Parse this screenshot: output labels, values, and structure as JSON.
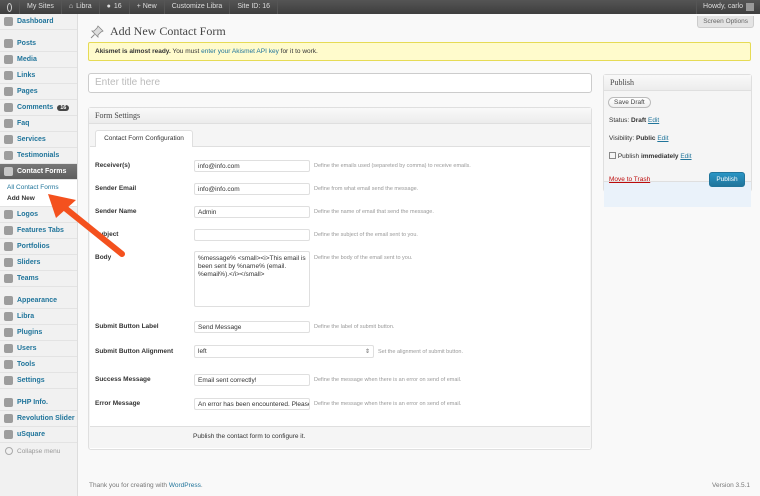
{
  "adminbar": {
    "items": [
      "My Sites",
      "Libra",
      "16",
      "+ New",
      "Customize Libra",
      "Site ID: 16"
    ],
    "howdy": "Howdy, carlo"
  },
  "sidebar": {
    "items": [
      {
        "label": "Dashboard",
        "icon": "dashboard-icon"
      },
      {
        "label": "Posts",
        "icon": "posts-icon"
      },
      {
        "label": "Media",
        "icon": "media-icon"
      },
      {
        "label": "Links",
        "icon": "links-icon"
      },
      {
        "label": "Pages",
        "icon": "pages-icon"
      },
      {
        "label": "Comments",
        "icon": "comments-icon",
        "badge": "16"
      },
      {
        "label": "Faq",
        "icon": "faq-icon"
      },
      {
        "label": "Services",
        "icon": "services-icon"
      },
      {
        "label": "Testimonials",
        "icon": "testimonials-icon"
      },
      {
        "label": "Contact Forms",
        "icon": "contact-forms-icon"
      },
      {
        "label": "Logos",
        "icon": "logos-icon"
      },
      {
        "label": "Features Tabs",
        "icon": "features-tabs-icon"
      },
      {
        "label": "Portfolios",
        "icon": "portfolios-icon"
      },
      {
        "label": "Sliders",
        "icon": "sliders-icon"
      },
      {
        "label": "Teams",
        "icon": "teams-icon"
      },
      {
        "label": "Appearance",
        "icon": "appearance-icon"
      },
      {
        "label": "Libra",
        "icon": "libra-icon"
      },
      {
        "label": "Plugins",
        "icon": "plugins-icon"
      },
      {
        "label": "Users",
        "icon": "users-icon"
      },
      {
        "label": "Tools",
        "icon": "tools-icon"
      },
      {
        "label": "Settings",
        "icon": "settings-icon"
      },
      {
        "label": "PHP Info.",
        "icon": "php-info-icon"
      },
      {
        "label": "Revolution Slider",
        "icon": "revolution-slider-icon"
      },
      {
        "label": "uSquare",
        "icon": "usquare-icon"
      }
    ],
    "submenu": [
      "All Contact Forms",
      "Add New"
    ],
    "collapse": "Collapse menu"
  },
  "screen_options": "Screen Options",
  "page_title": "Add New Contact Form",
  "notice": {
    "bold": "Akismet is almost ready.",
    "text1": "You must",
    "link": "enter your Akismet API key",
    "text2": "for it to work."
  },
  "title_placeholder": "Enter title here",
  "form_settings": {
    "heading": "Form Settings",
    "tab": "Contact Form Configuration",
    "fields": [
      {
        "label": "Receiver(s)",
        "value": "info@info.com",
        "desc": "Define the emails used (separeted by comma) to receive emails."
      },
      {
        "label": "Sender Email",
        "value": "info@info.com",
        "desc": "Define from what email send the message."
      },
      {
        "label": "Sender Name",
        "value": "Admin",
        "desc": "Define the name of email that send the message."
      },
      {
        "label": "Subject",
        "value": "",
        "desc": "Define the subject of the email sent to you."
      },
      {
        "label": "Body",
        "value": "%message%  <small><i>This email is been sent by %name% (email. %email%).</i></small>",
        "desc": "Define the body of the email sent to you."
      },
      {
        "label": "Submit Button Label",
        "value": "Send Message",
        "desc": "Define the label of submit button."
      },
      {
        "label": "Submit Button Alignment",
        "value": "left",
        "desc": "Set the alignment of submit button."
      },
      {
        "label": "Success Message",
        "value": "Email sent correctly!",
        "desc": "Define the message when there is an error on send of email."
      },
      {
        "label": "Error Message",
        "value": "An error has been encountered. Please try a",
        "desc": "Define the message when there is an error on send of email."
      }
    ],
    "footer": "Publish the contact form to configure it."
  },
  "publish": {
    "heading": "Publish",
    "save_draft": "Save Draft",
    "status_label": "Status:",
    "status_value": "Draft",
    "visibility_label": "Visibility:",
    "visibility_value": "Public",
    "publish_label": "Publish",
    "publish_value": "immediately",
    "edit": "Edit",
    "trash": "Move to Trash",
    "button": "Publish"
  },
  "footer": {
    "thanks": "Thank you for creating with",
    "link": "WordPress",
    "version": "Version 3.5.1"
  },
  "colors": {
    "accent": "#21759b",
    "annotation_arrow": "#f4511e"
  }
}
